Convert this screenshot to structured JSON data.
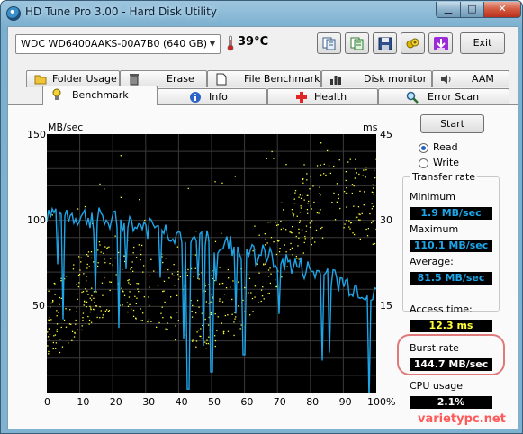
{
  "window": {
    "title": "HD Tune Pro 3.00 - Hard Disk Utility"
  },
  "toolbar": {
    "drive": "WDC WD6400AAKS-00A7B0 (640 GB)",
    "temperature": "39",
    "temperature_unit": "°C",
    "buttons": [
      "copy-icon",
      "copy-all-icon",
      "save-icon",
      "screenshot-icon",
      "download-icon"
    ],
    "exit_label": "Exit"
  },
  "tabs_top": [
    "Folder Usage",
    "Erase",
    "File Benchmark",
    "Disk monitor",
    "AAM"
  ],
  "tabs_bottom": [
    "Benchmark",
    "Info",
    "Health",
    "Error Scan"
  ],
  "active_tab": "Benchmark",
  "graph": {
    "left_unit": "MB/sec",
    "right_unit": "ms",
    "left_ticks": [
      "150",
      "100",
      "50"
    ],
    "right_ticks": [
      "45",
      "30",
      "15"
    ],
    "x_ticks": [
      "0",
      "10",
      "20",
      "30",
      "40",
      "50",
      "60",
      "70",
      "80",
      "90",
      "100%"
    ]
  },
  "controls": {
    "start_label": "Start",
    "read_label": "Read",
    "write_label": "Write",
    "selected": "Read"
  },
  "transfer": {
    "title": "Transfer rate",
    "minimum_label": "Minimum",
    "minimum": "1.9 MB/sec",
    "maximum_label": "Maximum",
    "maximum": "110.1 MB/sec",
    "average_label": "Average:",
    "average": "81.5 MB/sec"
  },
  "stats": {
    "access_label": "Access time:",
    "access": "12.3 ms",
    "burst_label": "Burst rate",
    "burst": "144.7 MB/sec",
    "cpu_label": "CPU usage",
    "cpu": "2.1%"
  },
  "colors": {
    "transfer_line": "#1ea5e8",
    "access_dots": "#ffff3c",
    "grid": "#3a3a3a"
  },
  "watermark": "varietypc.net"
}
